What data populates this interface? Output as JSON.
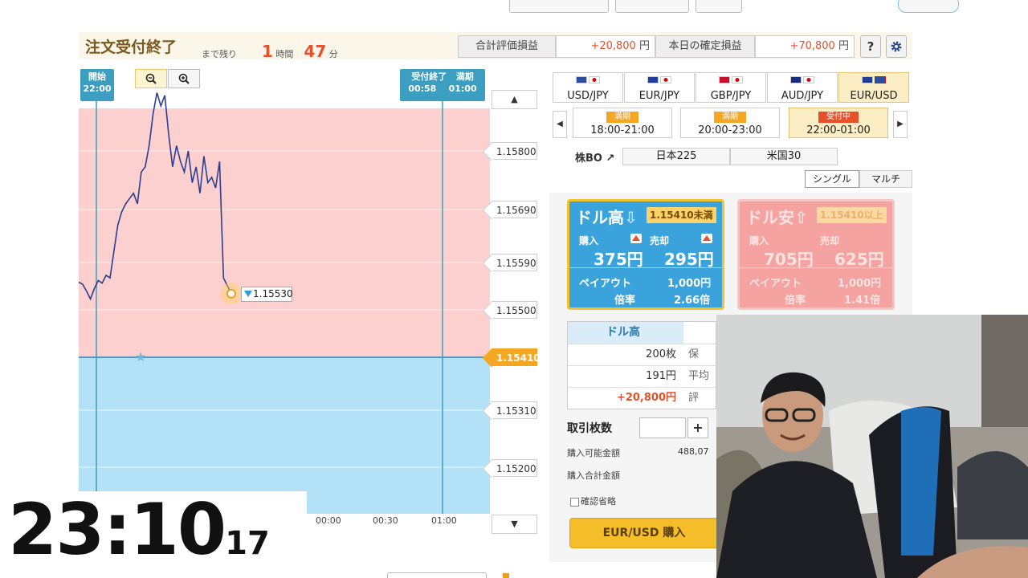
{
  "header": {
    "title": "注文受付終了",
    "remaining_label": "まで残り",
    "hours": "1",
    "hours_unit": "時間",
    "minutes": "47",
    "minutes_unit": "分",
    "eval_pl_label": "合計評価損益",
    "eval_pl_value": "+20,800",
    "yen": "円",
    "realized_pl_label": "本日の確定損益",
    "realized_pl_value": "+70,800",
    "help_icon": "?",
    "settings_icon": "gear-icon"
  },
  "chart": {
    "start_marker": {
      "label": "開始",
      "time": "22:00"
    },
    "close_marker": {
      "label": "受付終了",
      "time": "00:58"
    },
    "expiry_marker": {
      "label": "満期",
      "time": "01:00"
    },
    "current_price": "1.15530",
    "strike": "1.15410",
    "scroll_up": "▲",
    "scroll_down": "▼",
    "zoom_out_icon": "zoom-out-icon",
    "zoom_in_icon": "zoom-in-icon"
  },
  "chart_data": {
    "type": "line",
    "title": "",
    "xlabel": "",
    "ylabel": "",
    "x_ticks": [
      "00:00",
      "00:30",
      "01:00"
    ],
    "y_ticks": [
      "1.15800",
      "1.15690",
      "1.15590",
      "1.15500",
      "1.15410",
      "1.15310",
      "1.15200"
    ],
    "ylim": [
      1.1516,
      1.159
    ],
    "strike": 1.1541,
    "last_price": 1.1553,
    "series": [
      {
        "values": [
          1.15552,
          1.15548,
          1.15535,
          1.1552,
          1.1554,
          1.15555,
          1.1555,
          1.15565,
          1.1556,
          1.1561,
          1.1566,
          1.15685,
          1.157,
          1.1571,
          1.1572,
          1.157,
          1.1576,
          1.1577,
          1.1581,
          1.1587,
          1.1591,
          1.15885,
          1.15905,
          1.1583,
          1.1577,
          1.1581,
          1.1578,
          1.1576,
          1.158,
          1.1574,
          1.1577,
          1.1572,
          1.1579,
          1.1574,
          1.1575,
          1.1573,
          1.1578,
          1.1556,
          1.15545,
          1.1553
        ]
      }
    ]
  },
  "pairs": [
    {
      "label": "USD/JPY",
      "flag1": "#2b4d9c",
      "flag2": "#ffffff"
    },
    {
      "label": "EUR/JPY",
      "flag1": "#1f3f99",
      "flag2": "#ffffff"
    },
    {
      "label": "GBP/JPY",
      "flag1": "#c8102e",
      "flag2": "#ffffff"
    },
    {
      "label": "AUD/JPY",
      "flag1": "#1b2d7a",
      "flag2": "#ffffff"
    },
    {
      "label": "EUR/USD",
      "flag1": "#1f3f99",
      "flag2": "#2b4d9c"
    }
  ],
  "slots": [
    {
      "tag": "満期",
      "time": "18:00-21:00"
    },
    {
      "tag": "満期",
      "time": "20:00-23:00"
    },
    {
      "tag": "受付中",
      "time": "22:00-01:00"
    }
  ],
  "kabubo": "株BO",
  "indices": [
    "日本225",
    "米国30"
  ],
  "modes": [
    "シングル",
    "マルチ"
  ],
  "high_card": {
    "title": "ドル高",
    "threshold": "1.15410未満",
    "buy_label": "購入",
    "buy_price": "375円",
    "sell_label": "売却",
    "sell_price": "295円",
    "payout_label": "ペイアウト",
    "payout_value": "1,000円",
    "rate_label": "倍率",
    "rate_value": "2.66倍"
  },
  "low_card": {
    "title": "ドル安",
    "threshold": "1.15410以上",
    "buy_label": "購入",
    "buy_price": "705円",
    "sell_label": "売却",
    "sell_price": "625円",
    "payout_label": "ペイアウト",
    "payout_value": "1,000円",
    "rate_label": "倍率",
    "rate_value": "1.41倍"
  },
  "position": {
    "header": "ドル高",
    "qty": "200枚",
    "avg": "191円",
    "pl": "+20,800円",
    "cut1": "保",
    "cut2": "平均",
    "cut3": "評"
  },
  "order": {
    "qty_label": "取引枚数",
    "plus": "+",
    "avail_label": "購入可能金額",
    "avail_value": "488,07",
    "total_label": "購入合計金額",
    "confirm_label": "確認省略",
    "buy_button": "EUR/USD 購入"
  },
  "clock": {
    "hm": "23:10",
    "sec": "17"
  }
}
